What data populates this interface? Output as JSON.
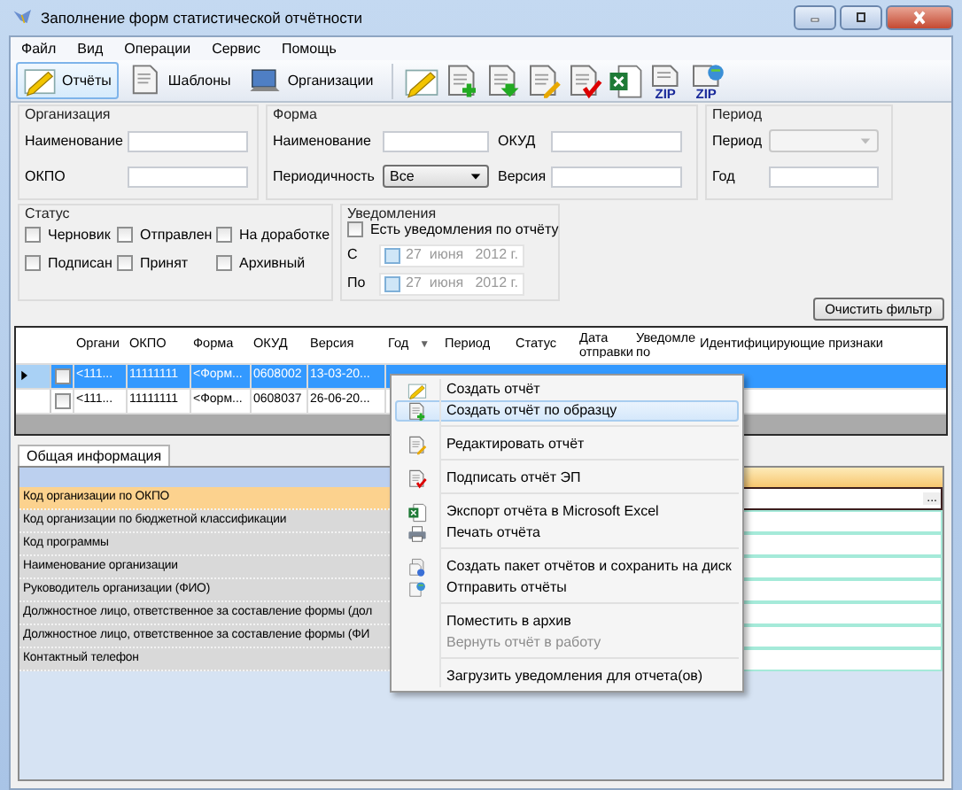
{
  "window": {
    "title": "Заполнение форм статистической отчётности"
  },
  "menu": [
    "Файл",
    "Вид",
    "Операции",
    "Сервис",
    "Помощь"
  ],
  "toolbar": {
    "views": [
      {
        "label": "Отчёты",
        "selected": true
      },
      {
        "label": "Шаблоны",
        "selected": false
      },
      {
        "label": "Организации",
        "selected": false
      }
    ],
    "actions": [
      {
        "kind": "create"
      },
      {
        "kind": "copy"
      },
      {
        "kind": "import"
      },
      {
        "kind": "edit"
      },
      {
        "kind": "sign"
      },
      {
        "kind": "export"
      },
      {
        "kind": "archive",
        "label": "ZIP"
      },
      {
        "kind": "send",
        "label": "ZIP"
      }
    ]
  },
  "filters": {
    "organization": {
      "title": "Организация",
      "fields": [
        {
          "label": "Наименование",
          "kind": "input"
        },
        {
          "label": "ОКПО",
          "kind": "input"
        }
      ]
    },
    "form": {
      "title": "Форма",
      "fields": [
        {
          "label": "Наименование",
          "kind": "input"
        },
        {
          "label": "ОКУД",
          "kind": "input"
        },
        {
          "label": "Периодичность",
          "kind": "select",
          "value": "Все"
        },
        {
          "label": "Версия",
          "kind": "input"
        }
      ]
    },
    "period": {
      "title": "Период",
      "fields": [
        {
          "label": "Период",
          "kind": "select",
          "disabled": true
        },
        {
          "label": "Год",
          "kind": "input"
        }
      ]
    },
    "status": {
      "title": "Статус",
      "options": [
        {
          "label": "Черновик",
          "checked": false
        },
        {
          "label": "Отправлен",
          "checked": false
        },
        {
          "label": "На доработке",
          "checked": false
        },
        {
          "label": "Подписан",
          "checked": false
        },
        {
          "label": "Принят",
          "checked": false
        },
        {
          "label": "Архивный",
          "checked": false
        }
      ]
    },
    "notifications": {
      "title": "Уведомления",
      "has_notifications": {
        "label": "Есть уведомления по отчёту",
        "checked": false
      },
      "dates": [
        {
          "label": "С",
          "checked": false,
          "day": "27",
          "month": "июня",
          "year": "2012 г."
        },
        {
          "label": "По",
          "checked": false,
          "day": "27",
          "month": "июня",
          "year": "2012 г."
        }
      ]
    },
    "clear_button": "Очистить фильтр"
  },
  "table": {
    "columns": [
      "Органи",
      "ОКПО",
      "Форма",
      "ОКУД",
      "Версия",
      "Год",
      "Период",
      "Статус",
      "Дата отправки",
      "Уведомле по",
      "Идентифицирующие признаки"
    ],
    "sort_glyph": "▼",
    "rows": [
      {
        "selected": true,
        "checked": false,
        "cells": [
          "<111...",
          "11111111",
          "<Форм...",
          "0608002",
          "13-03-20..."
        ]
      },
      {
        "selected": false,
        "checked": false,
        "cells": [
          "<111...",
          "11111111",
          "<Форм...",
          "0608037",
          "26-06-20..."
        ]
      }
    ]
  },
  "tabs": [
    {
      "label": "Общая информация",
      "selected": true
    }
  ],
  "properties": [
    {
      "label": "Код организации по ОКПО",
      "selected": true,
      "button": "..."
    },
    {
      "label": "Код организации по бюджетной классификации",
      "selected": false
    },
    {
      "label": "Код программы",
      "selected": false
    },
    {
      "label": "Наименование организации",
      "selected": false
    },
    {
      "label": "Руководитель организации (ФИО)",
      "selected": false
    },
    {
      "label": "Должностное лицо, ответственное за составление формы (дол",
      "selected": false
    },
    {
      "label": "Должностное лицо, ответственное за составление формы (ФИ",
      "selected": false
    },
    {
      "label": "Контактный телефон",
      "selected": false
    }
  ],
  "context_menu": [
    {
      "kind": "create",
      "label": "Создать отчёт",
      "selected": false,
      "disabled": false
    },
    {
      "kind": "copy",
      "label": "Создать отчёт по образцу",
      "selected": true,
      "disabled": false
    },
    {
      "kind": "separator"
    },
    {
      "kind": "edit",
      "label": "Редактировать отчёт",
      "selected": false,
      "disabled": false
    },
    {
      "kind": "separator"
    },
    {
      "kind": "sign",
      "label": "Подписать отчёт ЭП",
      "selected": false,
      "disabled": false
    },
    {
      "kind": "separator"
    },
    {
      "kind": "export",
      "label": "Экспорт отчёта в Microsoft Excel",
      "selected": false,
      "disabled": false
    },
    {
      "kind": "print",
      "label": "Печать отчёта",
      "selected": false,
      "disabled": false
    },
    {
      "kind": "separator"
    },
    {
      "kind": "package",
      "label": "Создать пакет отчётов и сохранить на диск",
      "selected": false,
      "disabled": false
    },
    {
      "kind": "send",
      "label": "Отправить отчёты",
      "selected": false,
      "disabled": false
    },
    {
      "kind": "separator"
    },
    {
      "kind": "plain",
      "label": "Поместить в архив",
      "selected": false,
      "disabled": false
    },
    {
      "kind": "plain",
      "label": "Вернуть отчёт в работу",
      "selected": false,
      "disabled": true
    },
    {
      "kind": "separator"
    },
    {
      "kind": "plain",
      "label": "Загрузить уведомления для отчета(ов)",
      "selected": false,
      "disabled": false
    }
  ]
}
